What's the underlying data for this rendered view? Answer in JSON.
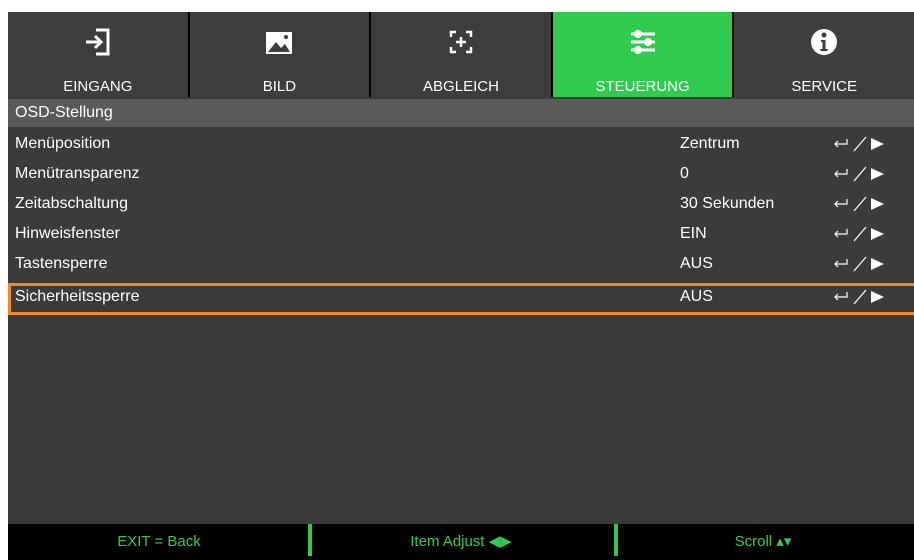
{
  "tabs": [
    {
      "label": "EINGANG",
      "icon": "input-arrow-icon",
      "active": false
    },
    {
      "label": "BILD",
      "icon": "image-icon",
      "active": false
    },
    {
      "label": "ABGLEICH",
      "icon": "alignment-icon",
      "active": false
    },
    {
      "label": "STEUERUNG",
      "icon": "sliders-icon",
      "active": true
    },
    {
      "label": "SERVICE",
      "icon": "info-icon",
      "active": false
    }
  ],
  "section": {
    "title": "OSD-Stellung"
  },
  "rows": [
    {
      "name": "Menüposition",
      "value": "Zentrum"
    },
    {
      "name": "Menütransparenz",
      "value": "0"
    },
    {
      "name": "Zeitabschaltung",
      "value": "30 Sekunden"
    },
    {
      "name": "Hinweisfenster",
      "value": "EIN"
    },
    {
      "name": "Tastensperre",
      "value": "AUS"
    },
    {
      "name": "Sicherheitssperre",
      "value": "AUS",
      "selected": true
    }
  ],
  "footer": {
    "exit": "EXIT = Back",
    "adjust": "Item Adjust ◀▶",
    "scroll": "Scroll ▴▾"
  },
  "colors": {
    "accent": "#2fcb4f",
    "highlight": "#f08a24",
    "panel": "#3b3b3b"
  }
}
